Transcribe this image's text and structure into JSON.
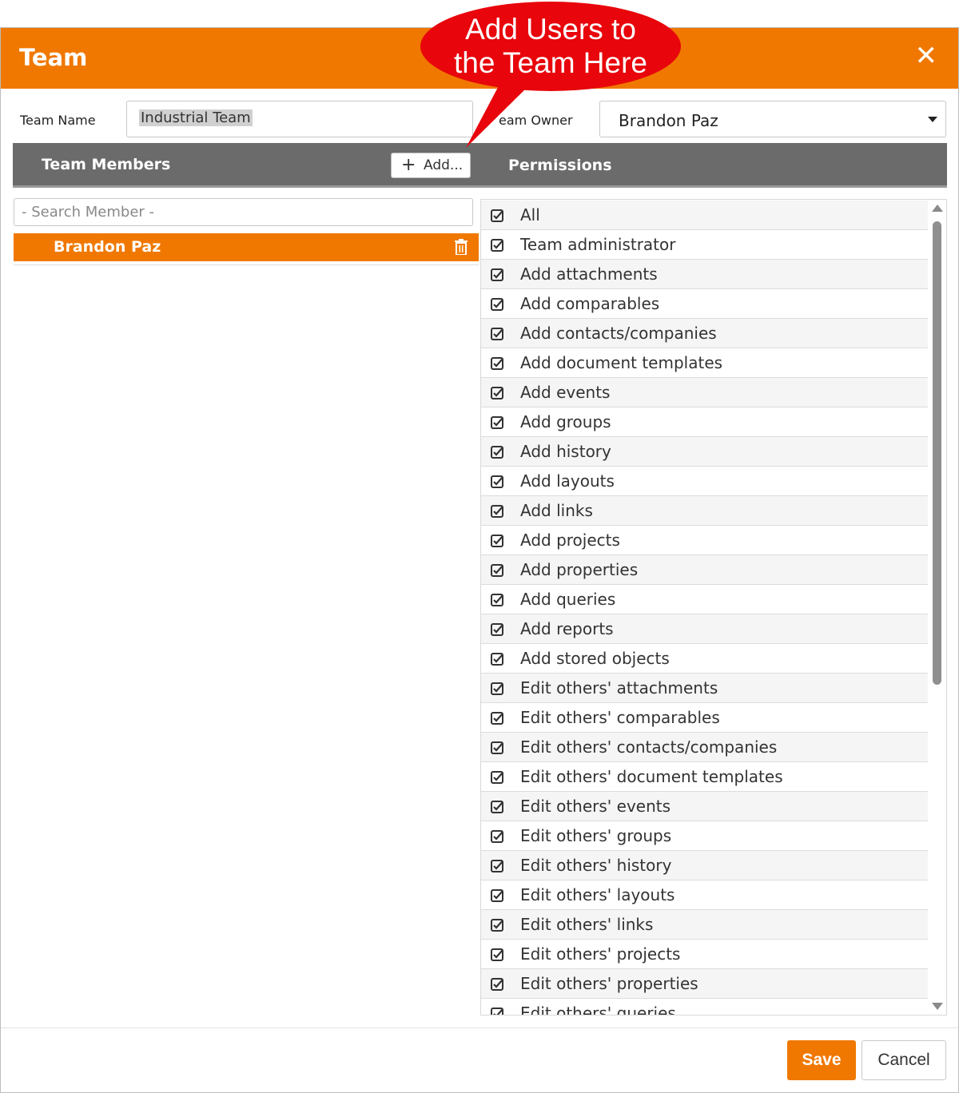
{
  "dialog": {
    "title": "Team",
    "close_label": "✕"
  },
  "form": {
    "team_name_label": "Team Name",
    "team_name_value": "Industrial Team",
    "team_owner_label": "eam Owner",
    "team_owner_value": "Brandon Paz"
  },
  "members": {
    "header": "Team Members",
    "add_label": "Add...",
    "search_placeholder": "- Search Member -",
    "items": [
      {
        "name": "Brandon Paz"
      }
    ]
  },
  "permissions": {
    "header": "Permissions",
    "items": [
      {
        "label": "All",
        "checked": true
      },
      {
        "label": "Team administrator",
        "checked": true
      },
      {
        "label": "Add attachments",
        "checked": true
      },
      {
        "label": "Add comparables",
        "checked": true
      },
      {
        "label": "Add contacts/companies",
        "checked": true
      },
      {
        "label": "Add document templates",
        "checked": true
      },
      {
        "label": "Add events",
        "checked": true
      },
      {
        "label": "Add groups",
        "checked": true
      },
      {
        "label": "Add history",
        "checked": true
      },
      {
        "label": "Add layouts",
        "checked": true
      },
      {
        "label": "Add links",
        "checked": true
      },
      {
        "label": "Add projects",
        "checked": true
      },
      {
        "label": "Add properties",
        "checked": true
      },
      {
        "label": "Add queries",
        "checked": true
      },
      {
        "label": "Add reports",
        "checked": true
      },
      {
        "label": "Add stored objects",
        "checked": true
      },
      {
        "label": "Edit others' attachments",
        "checked": true
      },
      {
        "label": "Edit others' comparables",
        "checked": true
      },
      {
        "label": "Edit others' contacts/companies",
        "checked": true
      },
      {
        "label": "Edit others' document templates",
        "checked": true
      },
      {
        "label": "Edit others' events",
        "checked": true
      },
      {
        "label": "Edit others' groups",
        "checked": true
      },
      {
        "label": "Edit others' history",
        "checked": true
      },
      {
        "label": "Edit others' layouts",
        "checked": true
      },
      {
        "label": "Edit others' links",
        "checked": true
      },
      {
        "label": "Edit others' projects",
        "checked": true
      },
      {
        "label": "Edit others' properties",
        "checked": true
      },
      {
        "label": "Edit others' queries",
        "checked": true
      }
    ]
  },
  "footer": {
    "save_label": "Save",
    "cancel_label": "Cancel"
  },
  "callout": {
    "line1": "Add Users to",
    "line2": "the Team Here"
  },
  "colors": {
    "accent": "#f07800",
    "header_gray": "#6b6b6b",
    "callout_red": "#e8050b"
  },
  "icons": {
    "close": "close-icon",
    "add": "plus-icon",
    "delete": "trash-icon",
    "checkbox": "checkbox-checked-icon",
    "scroll_up": "arrow-up-icon",
    "scroll_down": "arrow-down-icon",
    "dropdown": "chevron-down-icon"
  }
}
